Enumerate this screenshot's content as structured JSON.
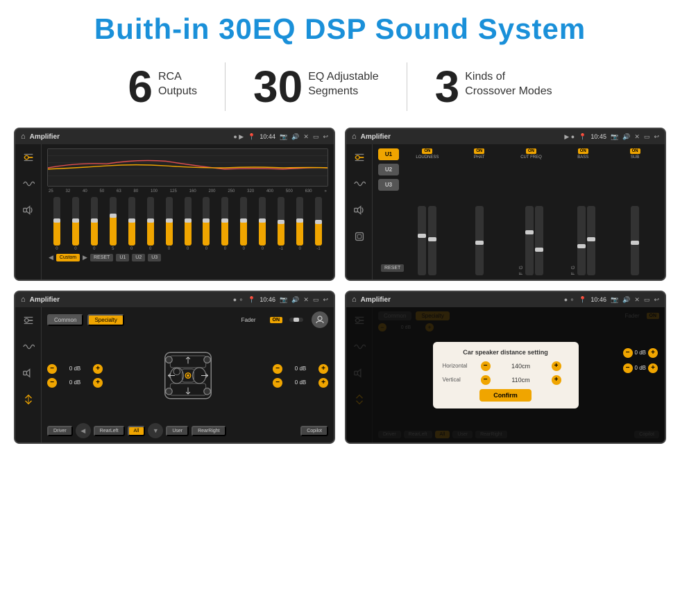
{
  "page": {
    "title": "Buith-in 30EQ DSP Sound System",
    "stats": [
      {
        "number": "6",
        "label": "RCA\nOutputs"
      },
      {
        "number": "30",
        "label": "EQ Adjustable\nSegments"
      },
      {
        "number": "3",
        "label": "Kinds of\nCrossover Modes"
      }
    ],
    "screens": [
      {
        "id": "eq-screen",
        "topbar": {
          "title": "Amplifier",
          "time": "10:44",
          "icons": "▶ ⚬"
        },
        "type": "eq"
      },
      {
        "id": "crossover-screen",
        "topbar": {
          "title": "Amplifier",
          "time": "10:45",
          "icons": "▶ ⚬"
        },
        "type": "crossover"
      },
      {
        "id": "fader-screen",
        "topbar": {
          "title": "Amplifier",
          "time": "10:46",
          "icons": "● ⚬"
        },
        "type": "fader"
      },
      {
        "id": "dialog-screen",
        "topbar": {
          "title": "Amplifier",
          "time": "10:46",
          "icons": "● ⚬"
        },
        "type": "dialog",
        "dialog": {
          "title": "Car speaker distance setting",
          "horizontal_label": "Horizontal",
          "horizontal_value": "140cm",
          "vertical_label": "Vertical",
          "vertical_value": "110cm",
          "confirm_label": "Confirm"
        }
      }
    ],
    "eq": {
      "freqs": [
        "25",
        "32",
        "40",
        "50",
        "63",
        "80",
        "100",
        "125",
        "160",
        "200",
        "250",
        "320",
        "400",
        "500",
        "630"
      ],
      "values": [
        "0",
        "0",
        "0",
        "5",
        "0",
        "0",
        "0",
        "0",
        "0",
        "0",
        "0",
        "0",
        "-1",
        "0",
        "-1"
      ],
      "controls": [
        "Custom",
        "RESET",
        "U1",
        "U2",
        "U3"
      ]
    },
    "crossover": {
      "presets": [
        "U1",
        "U2",
        "U3"
      ],
      "groups": [
        {
          "label": "LOUDNESS",
          "on": true
        },
        {
          "label": "PHAT",
          "on": true
        },
        {
          "label": "CUT FREQ",
          "on": true
        },
        {
          "label": "BASS",
          "on": true
        },
        {
          "label": "SUB",
          "on": true
        }
      ],
      "reset_label": "RESET"
    },
    "fader": {
      "tabs": [
        "Common",
        "Specialty"
      ],
      "fader_label": "Fader",
      "on_label": "ON",
      "left_dbs": [
        "0 dB",
        "0 dB"
      ],
      "right_dbs": [
        "0 dB",
        "0 dB"
      ],
      "bottom_btns": [
        "Driver",
        "RearLeft",
        "All",
        "User",
        "RearRight",
        "Copilot"
      ]
    }
  }
}
